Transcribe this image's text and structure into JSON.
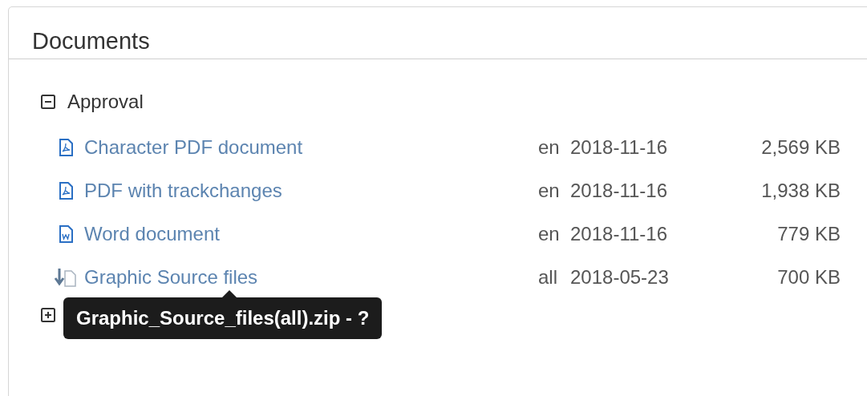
{
  "panel": {
    "title": "Documents"
  },
  "groups": [
    {
      "label": "Approval",
      "expanded": true,
      "items": [
        {
          "kind": "pdf",
          "name": "Character PDF document",
          "language": "en",
          "date": "2018-11-16",
          "size": "2,569 KB"
        },
        {
          "kind": "pdf",
          "name": "PDF with trackchanges",
          "language": "en",
          "date": "2018-11-16",
          "size": "1,938 KB"
        },
        {
          "kind": "word",
          "name": "Word document",
          "language": "en",
          "date": "2018-11-16",
          "size": "779 KB"
        },
        {
          "kind": "archive",
          "name": "Graphic Source files",
          "language": "all",
          "date": "2018-05-23",
          "size": "700 KB",
          "tooltip": "Graphic_Source_files(all).zip - ?"
        }
      ]
    },
    {
      "expanded": false
    }
  ]
}
